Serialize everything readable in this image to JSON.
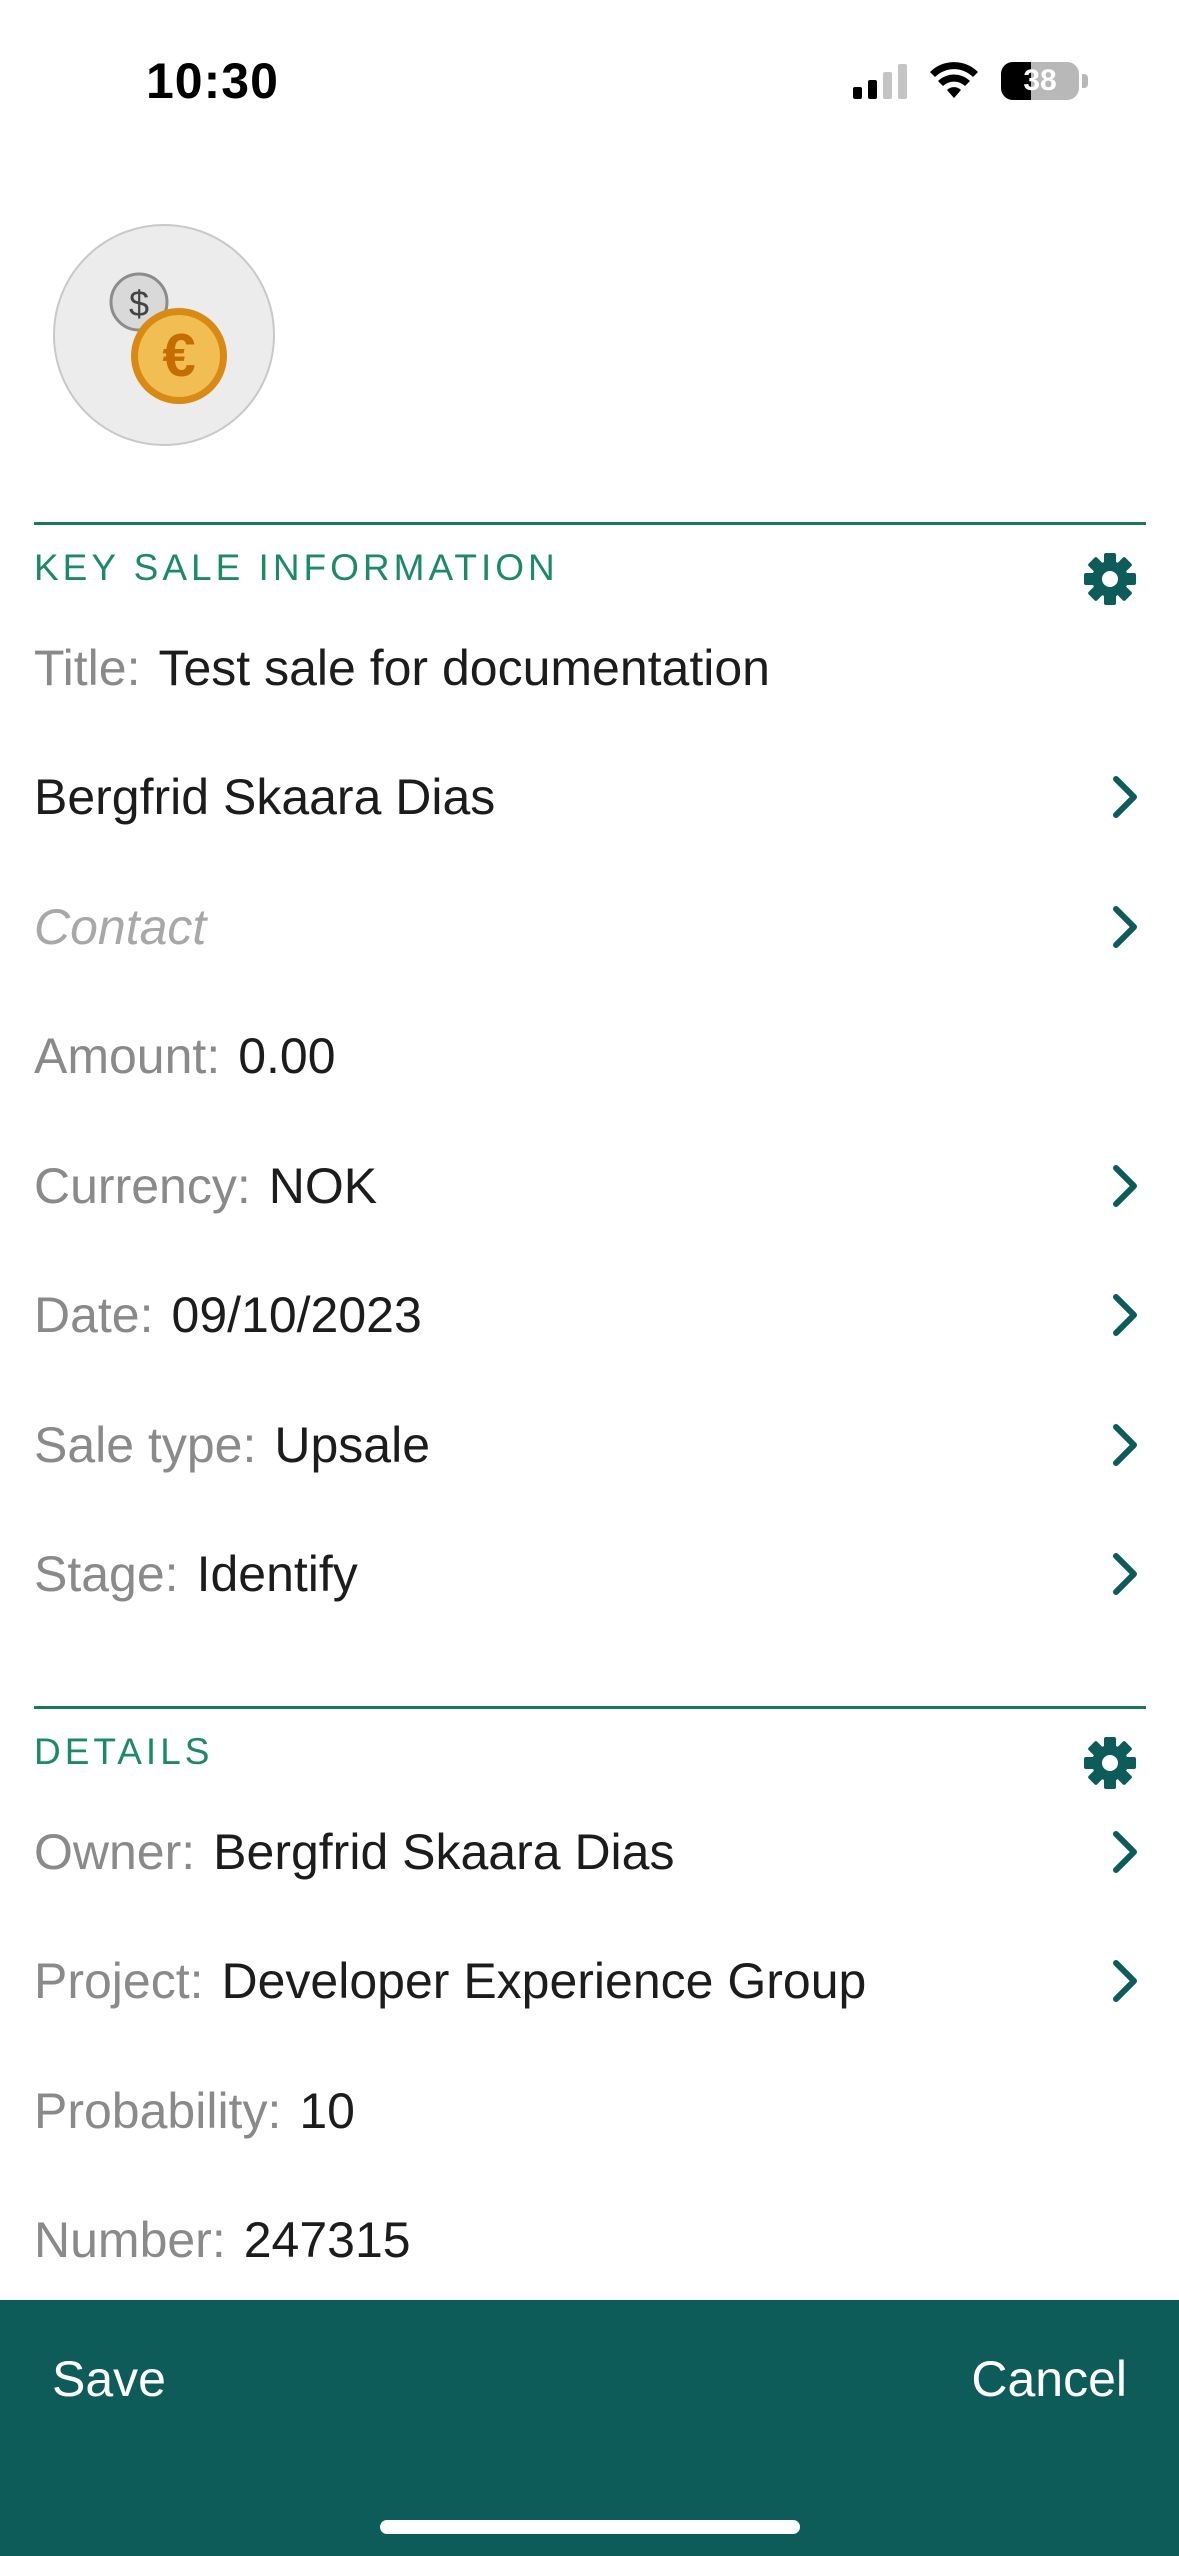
{
  "status_bar": {
    "time": "10:30",
    "battery": "38"
  },
  "avatar": {
    "icon": "euro-dollar-coins-icon"
  },
  "key_sale": {
    "title": "KEY SALE INFORMATION",
    "title_label": "Title:",
    "title_value": "Test sale for documentation",
    "company": "Bergfrid Skaara Dias",
    "contact_placeholder": "Contact",
    "amount_label": "Amount:",
    "amount_value": "0.00",
    "currency_label": "Currency:",
    "currency_value": "NOK",
    "date_label": "Date:",
    "date_value": "09/10/2023",
    "sale_type_label": "Sale type:",
    "sale_type_value": "Upsale",
    "stage_label": "Stage:",
    "stage_value": "Identify"
  },
  "details": {
    "title": "DETAILS",
    "owner_label": "Owner:",
    "owner_value": "Bergfrid Skaara Dias",
    "project_label": "Project:",
    "project_value": "Developer Experience Group",
    "probability_label": "Probability:",
    "probability_value": "10",
    "number_label": "Number:",
    "number_value": "247315"
  },
  "toolbar": {
    "save": "Save",
    "cancel": "Cancel"
  },
  "colors": {
    "accent": "#1d8a66",
    "toolbar": "#0d5c5a",
    "chevron": "#0d5c5a"
  }
}
